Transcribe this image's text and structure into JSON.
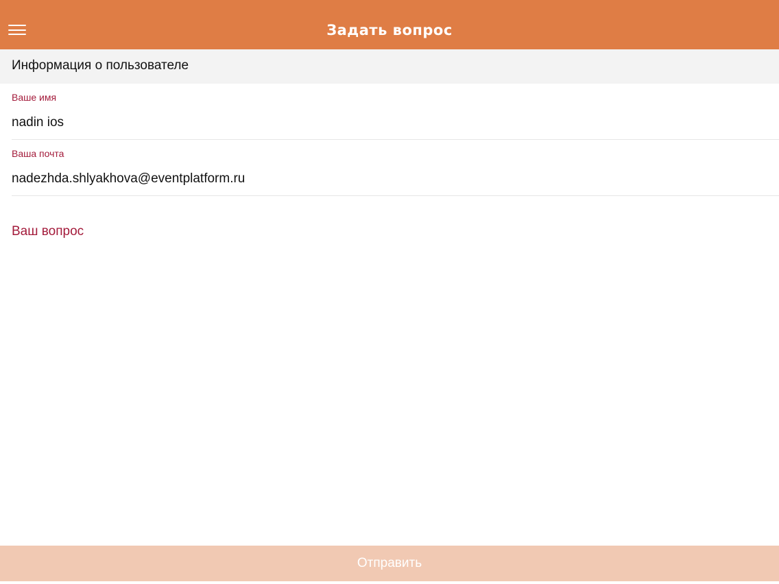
{
  "header": {
    "title": "Задать вопрос",
    "menu_icon": "hamburger-menu-icon",
    "background_color": "#df7d45"
  },
  "user_info": {
    "section_title": "Информация о пользователе",
    "name_label": "Ваше имя",
    "name_value": "nadin ios",
    "email_label": "Ваша почта",
    "email_value": "nadezhda.shlyakhova@eventplatform.ru"
  },
  "question": {
    "label": "Ваш вопрос",
    "value": ""
  },
  "actions": {
    "submit_label": "Отправить",
    "submit_disabled": true
  },
  "colors": {
    "accent": "#df7d45",
    "label": "#a31a3a",
    "submit_disabled": "#f1c9b3"
  }
}
